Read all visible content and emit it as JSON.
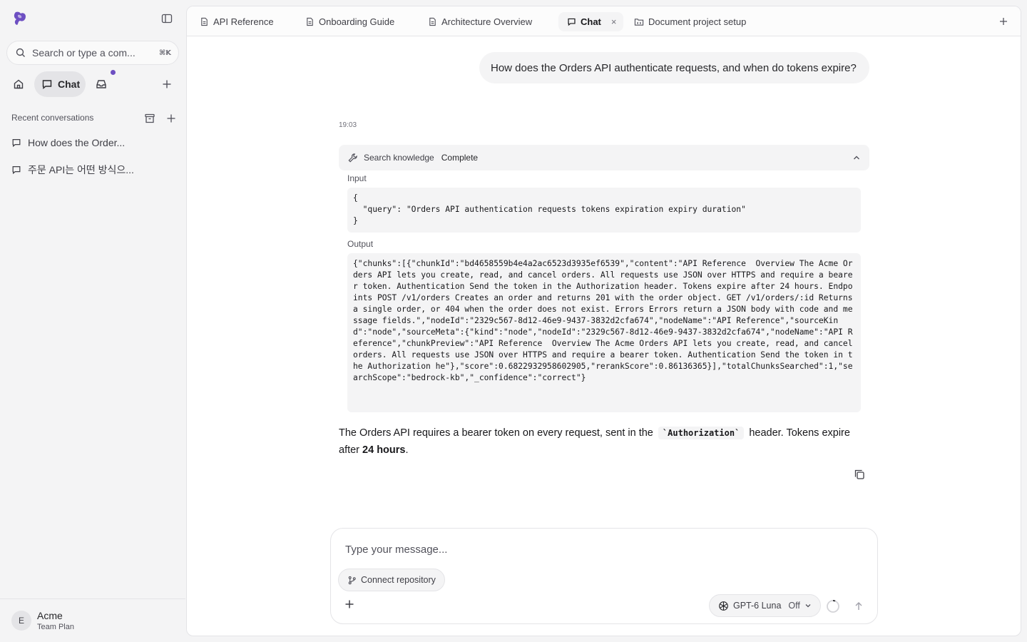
{
  "sidebar": {
    "search_placeholder": "Search or type a com...",
    "search_shortcut": "⌘K",
    "nav": {
      "chat_label": "Chat"
    },
    "recent_header": "Recent conversations",
    "conversations": [
      {
        "label": "How does the Order..."
      },
      {
        "label": "주문 API는 어떤 방식으..."
      }
    ],
    "user": {
      "initial": "E",
      "name": "Acme",
      "plan": "Team Plan"
    }
  },
  "tabs": [
    {
      "label": "API Reference",
      "icon": "document-icon"
    },
    {
      "label": "Onboarding Guide",
      "icon": "document-icon"
    },
    {
      "label": "Architecture Overview",
      "icon": "document-icon"
    },
    {
      "label": "Chat",
      "icon": "chat-icon",
      "active": true,
      "close": "×"
    },
    {
      "label": "Document project setup",
      "icon": "folder-code-icon"
    }
  ],
  "conversation": {
    "user_message": "How does the Orders API authenticate requests, and when do tokens expire?",
    "timestamp": "19:03",
    "tool": {
      "name": "Search knowledge",
      "status": "Complete",
      "input_label": "Input",
      "input": "{\n  \"query\": \"Orders API authentication requests tokens expiration expiry duration\"\n}",
      "output_label": "Output",
      "output": "{\"chunks\":[{\"chunkId\":\"bd4658559b4e4a2ac6523d3935ef6539\",\"content\":\"API Reference  Overview The Acme Orders API lets you create, read, and cancel orders. All requests use JSON over HTTPS and require a bearer token. Authentication Send the token in the Authorization header. Tokens expire after 24 hours. Endpoints POST /v1/orders Creates an order and returns 201 with the order object. GET /v1/orders/:id Returns a single order, or 404 when the order does not exist. Errors Errors return a JSON body with code and message fields.\",\"nodeId\":\"2329c567-8d12-46e9-9437-3832d2cfa674\",\"nodeName\":\"API Reference\",\"sourceKind\":\"node\",\"sourceMeta\":{\"kind\":\"node\",\"nodeId\":\"2329c567-8d12-46e9-9437-3832d2cfa674\",\"nodeName\":\"API Reference\",\"chunkPreview\":\"API Reference  Overview The Acme Orders API lets you create, read, and cancel orders. All requests use JSON over HTTPS and require a bearer token. Authentication Send the token in the Authorization he\"},\"score\":0.6822932958602905,\"rerankScore\":0.86136365}],\"totalChunksSearched\":1,\"searchScope\":\"bedrock-kb\",\"_confidence\":\"correct\"}"
    },
    "answer": {
      "part1": "The Orders API requires a bearer token on every request, sent in the",
      "code": "`Authorization`",
      "part2": "header. Tokens expire after",
      "bold": "24 hours",
      "part3": "."
    }
  },
  "composer": {
    "placeholder": "Type your message...",
    "connect_repo_label": "Connect repository",
    "model_name": "GPT-6 Luna",
    "model_mode": "Off"
  },
  "colors": {
    "accent": "#6d4fc2",
    "sidebar_bg": "#f4f4f5",
    "panel_bg": "#ffffff",
    "border": "#e4e4e7"
  }
}
